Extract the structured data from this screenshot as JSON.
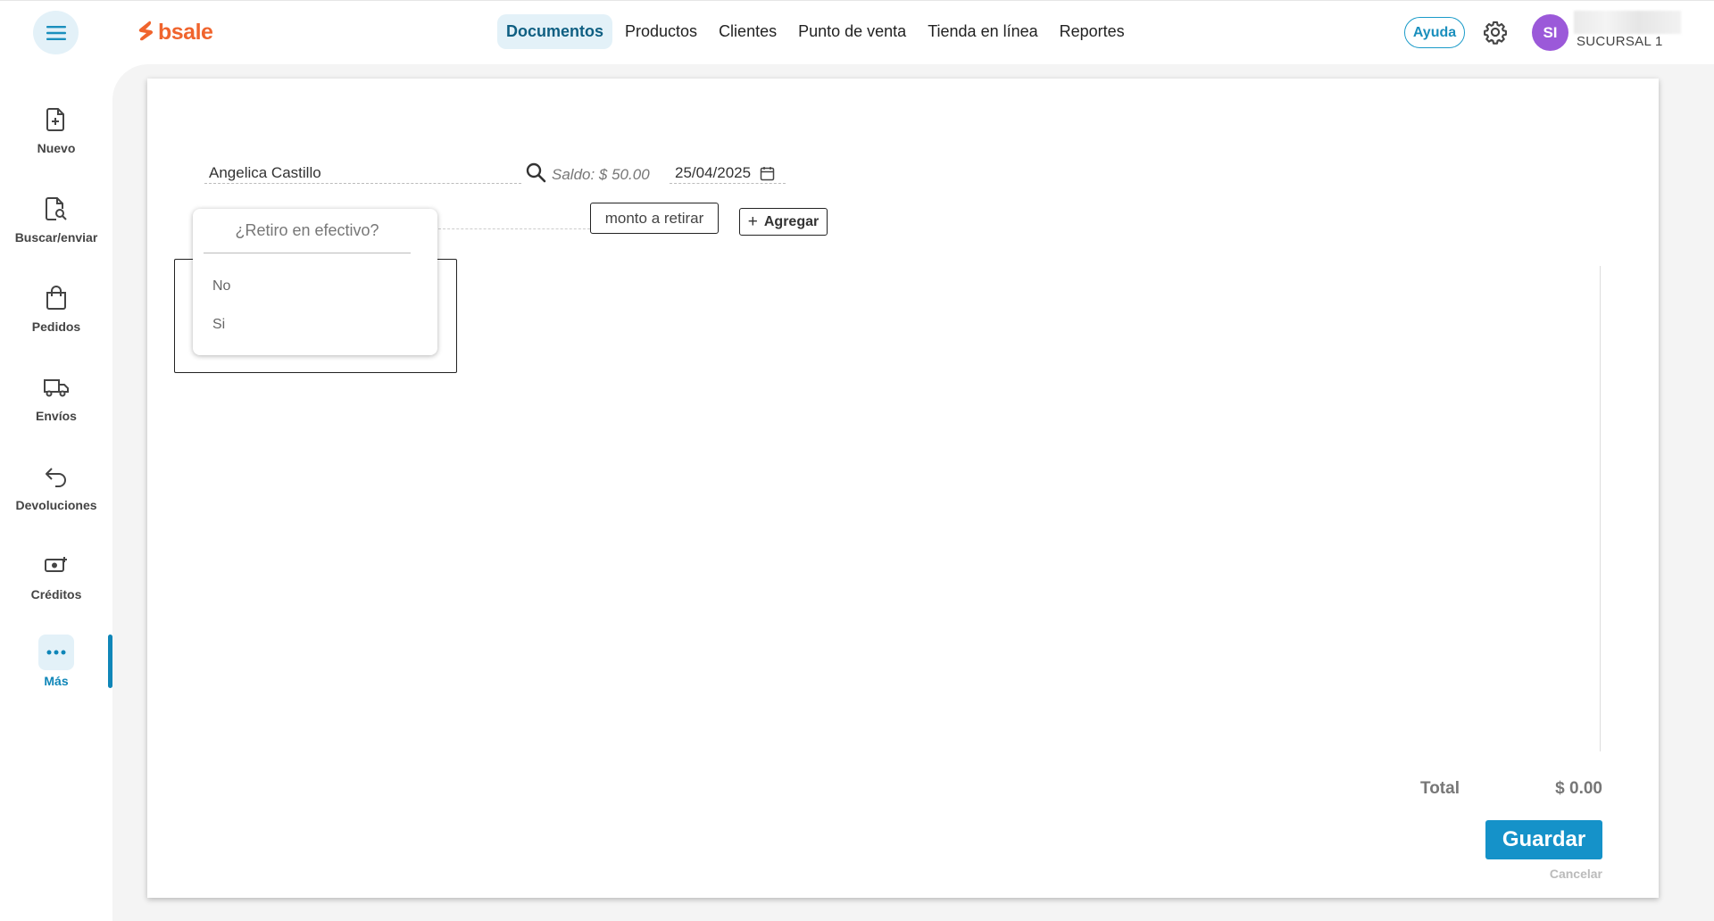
{
  "app": {
    "logo_text": "bsale",
    "brand_color": "#f0642d",
    "accent_color": "#1592c9"
  },
  "topnav": {
    "items": [
      {
        "label": "Documentos",
        "active": true
      },
      {
        "label": "Productos"
      },
      {
        "label": "Clientes"
      },
      {
        "label": "Punto de venta"
      },
      {
        "label": "Tienda en línea"
      },
      {
        "label": "Reportes"
      }
    ],
    "help_label": "Ayuda",
    "avatar_initials": "SI",
    "branch_label": "SUCURSAL 1"
  },
  "sidebar": {
    "items": [
      {
        "label": "Nuevo",
        "icon": "file-plus-icon"
      },
      {
        "label": "Buscar/enviar",
        "icon": "file-search-icon"
      },
      {
        "label": "Pedidos",
        "icon": "bag-icon"
      },
      {
        "label": "Envíos",
        "icon": "truck-icon"
      },
      {
        "label": "Devoluciones",
        "icon": "return-arrow-icon"
      },
      {
        "label": "Créditos",
        "icon": "cash-plus-icon"
      },
      {
        "label": "Más",
        "icon": "more-dots-icon",
        "active": true
      }
    ]
  },
  "form": {
    "client_name": "Angelica Castillo",
    "saldo": "Saldo: $ 50.00",
    "date": "25/04/2025",
    "amount_placeholder": "monto a retirar",
    "add_label": "Agregar",
    "dropdown": {
      "header": "¿Retiro en efectivo?",
      "options": [
        "No",
        "Si"
      ]
    }
  },
  "footer": {
    "total_label": "Total",
    "total_value": "$ 0.00",
    "save_label": "Guardar",
    "cancel_label": "Cancelar"
  }
}
